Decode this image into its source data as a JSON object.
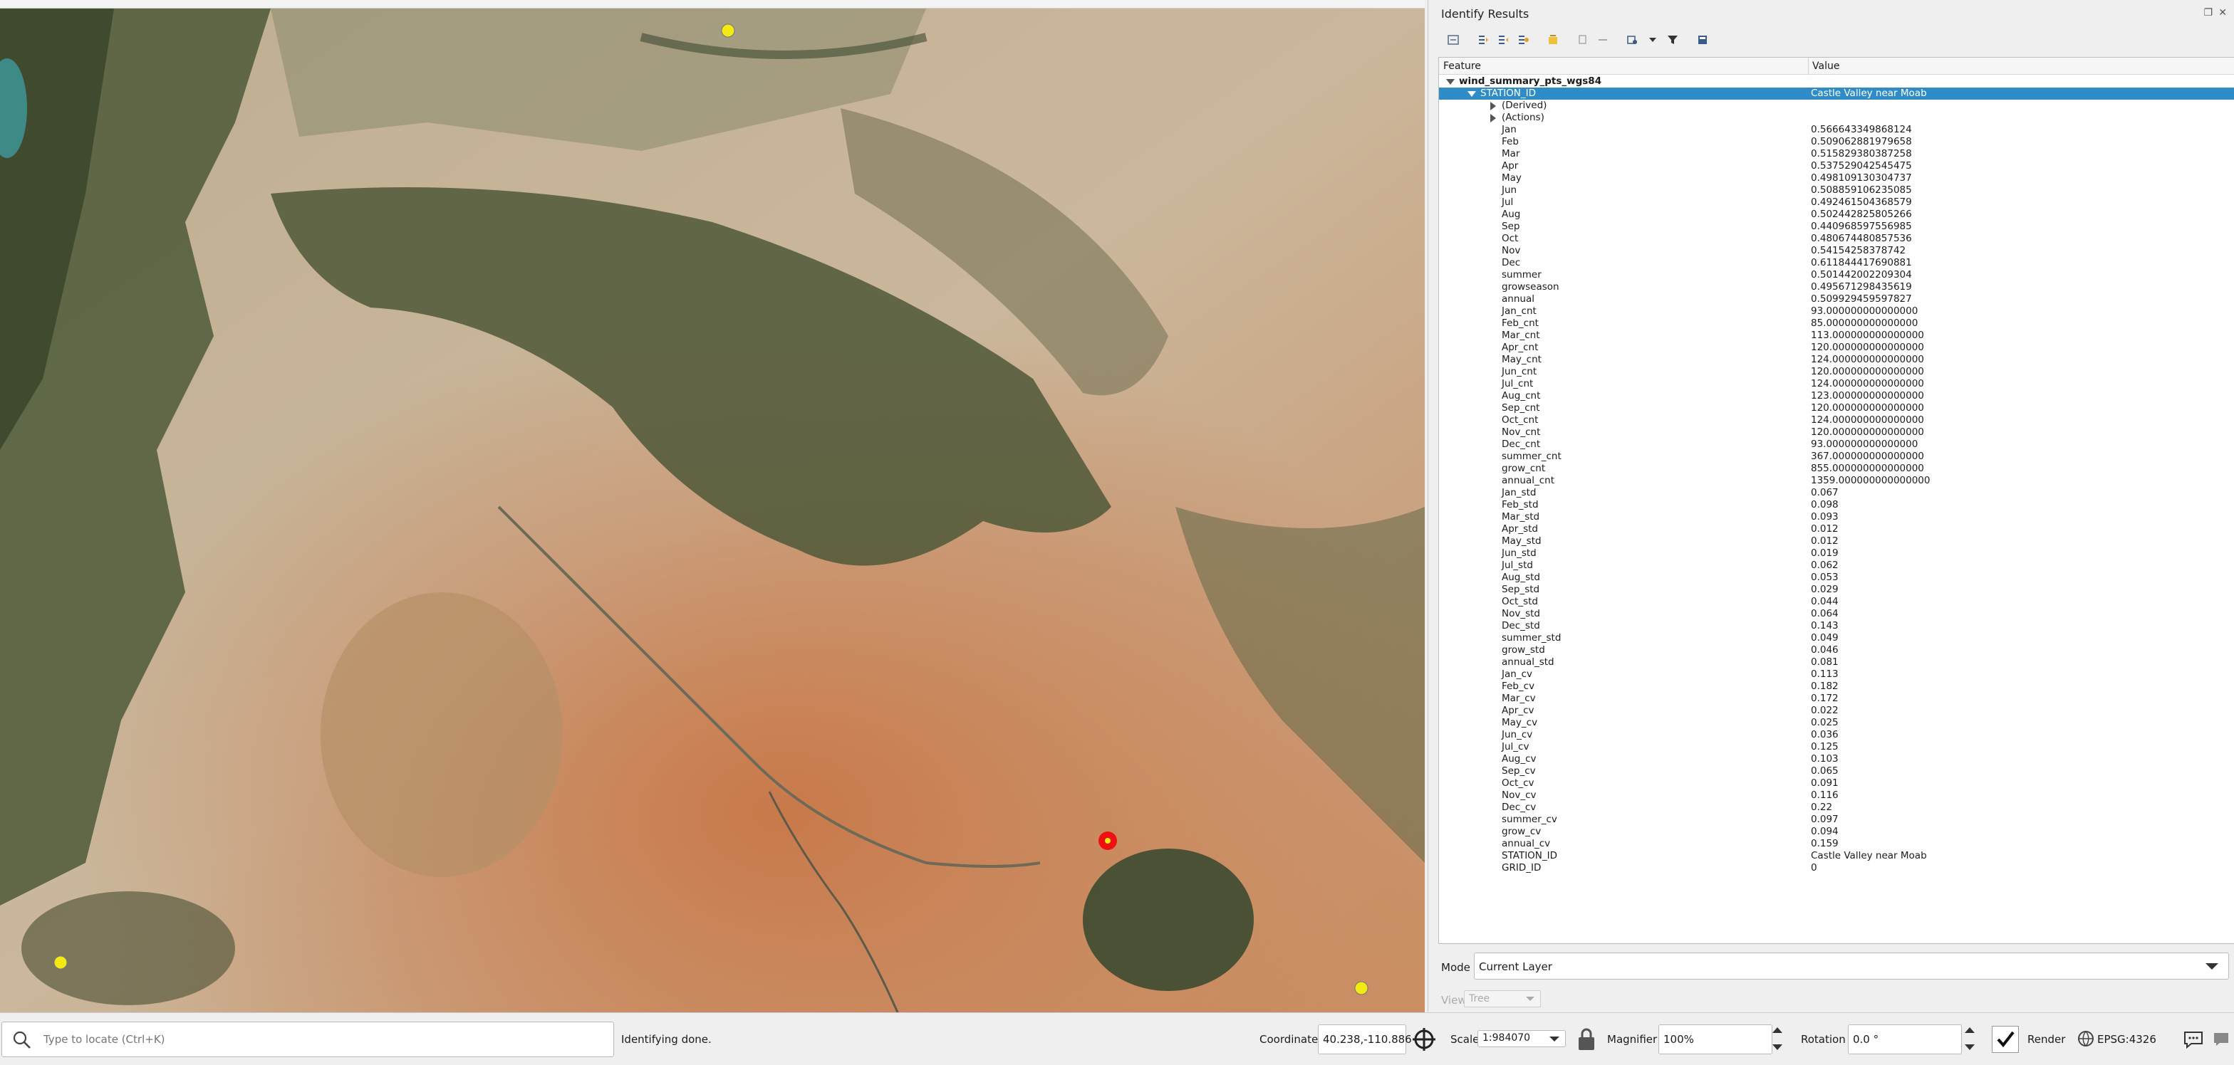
{
  "map": {
    "points": [
      {
        "name": "station-point",
        "color": "#f2ea10"
      },
      {
        "name": "station-point",
        "color": "#f2ea10"
      },
      {
        "name": "station-point",
        "color": "#f2ea10"
      },
      {
        "name": "selected-station-point",
        "color": "#ee1111"
      }
    ]
  },
  "panel": {
    "title": "Identify Results",
    "columns": {
      "feature": "Feature",
      "value": "Value"
    },
    "layer_name": "wind_summary_pts_wgs84",
    "selected": {
      "field": "STATION_ID",
      "value": "Castle Valley near Moab"
    },
    "groups": [
      "(Derived)",
      "(Actions)"
    ],
    "attributes": [
      {
        "f": "Jan",
        "v": "0.566643349868124"
      },
      {
        "f": "Feb",
        "v": "0.509062881979658"
      },
      {
        "f": "Mar",
        "v": "0.515829380387258"
      },
      {
        "f": "Apr",
        "v": "0.537529042545475"
      },
      {
        "f": "May",
        "v": "0.498109130304737"
      },
      {
        "f": "Jun",
        "v": "0.508859106235085"
      },
      {
        "f": "Jul",
        "v": "0.492461504368579"
      },
      {
        "f": "Aug",
        "v": "0.502442825805266"
      },
      {
        "f": "Sep",
        "v": "0.440968597556985"
      },
      {
        "f": "Oct",
        "v": "0.480674480857536"
      },
      {
        "f": "Nov",
        "v": "0.54154258378742"
      },
      {
        "f": "Dec",
        "v": "0.611844417690881"
      },
      {
        "f": "summer",
        "v": "0.501442002209304"
      },
      {
        "f": "growseason",
        "v": "0.495671298435619"
      },
      {
        "f": "annual",
        "v": "0.509929459597827"
      },
      {
        "f": "Jan_cnt",
        "v": "93.000000000000000"
      },
      {
        "f": "Feb_cnt",
        "v": "85.000000000000000"
      },
      {
        "f": "Mar_cnt",
        "v": "113.000000000000000"
      },
      {
        "f": "Apr_cnt",
        "v": "120.000000000000000"
      },
      {
        "f": "May_cnt",
        "v": "124.000000000000000"
      },
      {
        "f": "Jun_cnt",
        "v": "120.000000000000000"
      },
      {
        "f": "Jul_cnt",
        "v": "124.000000000000000"
      },
      {
        "f": "Aug_cnt",
        "v": "123.000000000000000"
      },
      {
        "f": "Sep_cnt",
        "v": "120.000000000000000"
      },
      {
        "f": "Oct_cnt",
        "v": "124.000000000000000"
      },
      {
        "f": "Nov_cnt",
        "v": "120.000000000000000"
      },
      {
        "f": "Dec_cnt",
        "v": "93.000000000000000"
      },
      {
        "f": "summer_cnt",
        "v": "367.000000000000000"
      },
      {
        "f": "grow_cnt",
        "v": "855.000000000000000"
      },
      {
        "f": "annual_cnt",
        "v": "1359.000000000000000"
      },
      {
        "f": "Jan_std",
        "v": "0.067"
      },
      {
        "f": "Feb_std",
        "v": "0.098"
      },
      {
        "f": "Mar_std",
        "v": "0.093"
      },
      {
        "f": "Apr_std",
        "v": "0.012"
      },
      {
        "f": "May_std",
        "v": "0.012"
      },
      {
        "f": "Jun_std",
        "v": "0.019"
      },
      {
        "f": "Jul_std",
        "v": "0.062"
      },
      {
        "f": "Aug_std",
        "v": "0.053"
      },
      {
        "f": "Sep_std",
        "v": "0.029"
      },
      {
        "f": "Oct_std",
        "v": "0.044"
      },
      {
        "f": "Nov_std",
        "v": "0.064"
      },
      {
        "f": "Dec_std",
        "v": "0.143"
      },
      {
        "f": "summer_std",
        "v": "0.049"
      },
      {
        "f": "grow_std",
        "v": "0.046"
      },
      {
        "f": "annual_std",
        "v": "0.081"
      },
      {
        "f": "Jan_cv",
        "v": "0.113"
      },
      {
        "f": "Feb_cv",
        "v": "0.182"
      },
      {
        "f": "Mar_cv",
        "v": "0.172"
      },
      {
        "f": "Apr_cv",
        "v": "0.022"
      },
      {
        "f": "May_cv",
        "v": "0.025"
      },
      {
        "f": "Jun_cv",
        "v": "0.036"
      },
      {
        "f": "Jul_cv",
        "v": "0.125"
      },
      {
        "f": "Aug_cv",
        "v": "0.103"
      },
      {
        "f": "Sep_cv",
        "v": "0.065"
      },
      {
        "f": "Oct_cv",
        "v": "0.091"
      },
      {
        "f": "Nov_cv",
        "v": "0.116"
      },
      {
        "f": "Dec_cv",
        "v": "0.22"
      },
      {
        "f": "summer_cv",
        "v": "0.097"
      },
      {
        "f": "grow_cv",
        "v": "0.094"
      },
      {
        "f": "annual_cv",
        "v": "0.159"
      },
      {
        "f": "STATION_ID",
        "v": "Castle Valley near Moab"
      },
      {
        "f": "GRID_ID",
        "v": "0"
      }
    ],
    "mode_label": "Mode",
    "mode_value": "Current Layer",
    "view_label": "View",
    "view_value": "Tree",
    "selection_color": "#308cc6"
  },
  "status": {
    "locator_placeholder": "Type to locate (Ctrl+K)",
    "message": "Identifying done.",
    "coordinate_label": "Coordinate",
    "coordinate_value": "40.238,-110.886",
    "scale_label": "Scale",
    "scale_value": "1:984070",
    "magnifier_label": "Magnifier",
    "magnifier_value": "100%",
    "rotation_label": "Rotation",
    "rotation_value": "0.0 °",
    "render_label": "Render",
    "crs_value": "EPSG:4326"
  }
}
